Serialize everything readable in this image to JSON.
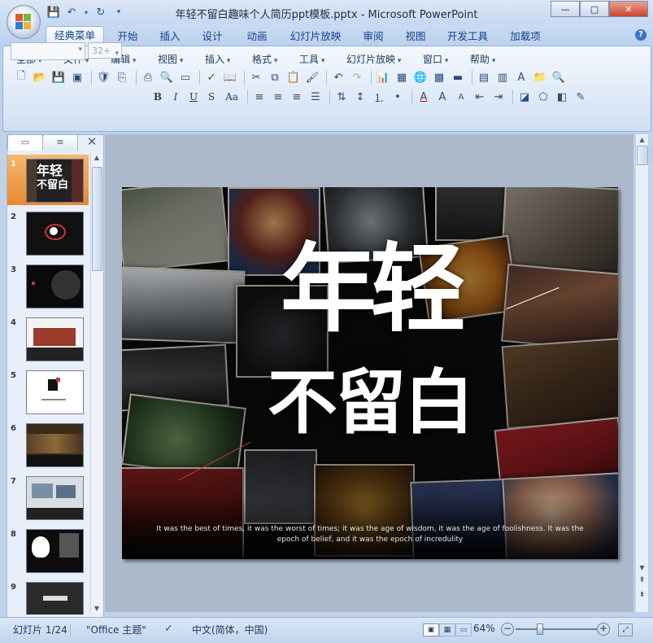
{
  "window": {
    "title": "年轻不留白趣味个人简历ppt模板.pptx - Microsoft PowerPoint",
    "minimize": "—",
    "maximize": "▢",
    "close": "✕"
  },
  "quick_access": {
    "items": [
      "save-icon",
      "undo-icon",
      "redo-icon",
      "customize-icon"
    ]
  },
  "ribbon_tabs": [
    "经典菜单",
    "开始",
    "插入",
    "设计",
    "动画",
    "幻灯片放映",
    "审阅",
    "视图",
    "开发工具",
    "加载项"
  ],
  "active_tab": "经典菜单",
  "menus": [
    "全部",
    "文件",
    "编辑",
    "视图",
    "插入",
    "格式",
    "工具",
    "幻灯片放映",
    "窗口",
    "帮助"
  ],
  "font": {
    "name": "",
    "size_placeholder": "32+"
  },
  "format_buttons": [
    "B",
    "I",
    "U",
    "S",
    "Aa"
  ],
  "pane": {
    "tab_slides": "▭",
    "tab_outline": "≡",
    "close": "✕",
    "slides": [
      {
        "num": "1",
        "selected": true
      },
      {
        "num": "2",
        "selected": false
      },
      {
        "num": "3",
        "selected": false
      },
      {
        "num": "4",
        "selected": false
      },
      {
        "num": "5",
        "selected": false
      },
      {
        "num": "6",
        "selected": false
      },
      {
        "num": "7",
        "selected": false
      },
      {
        "num": "8",
        "selected": false
      },
      {
        "num": "9",
        "selected": false
      }
    ]
  },
  "slide": {
    "title": "年轻",
    "subtitle": "不留白",
    "quote_line1": "It was the best of times, it was the worst of times; it was the age of wisdom, it was the age of foolishness. It was the",
    "quote_line2": "epoch of belief, and it was the epoch of incredulity",
    "background": "#0d0d0d"
  },
  "status": {
    "slide_info": "幻灯片 1/24",
    "theme": "\"Office 主题\"",
    "language": "中文(简体，中国)",
    "zoom": "64%"
  }
}
